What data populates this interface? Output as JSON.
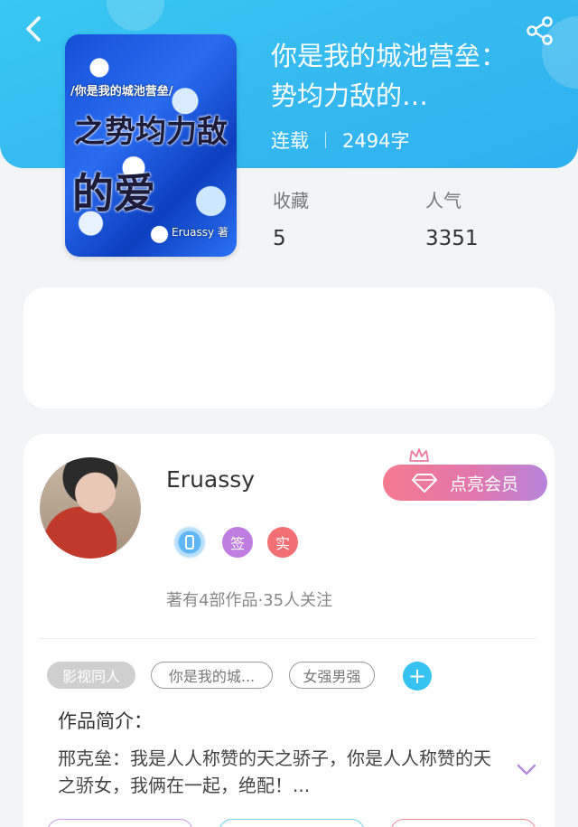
{
  "book": {
    "title": "你是我的城池营垒：势均力敌的…",
    "status": "连载",
    "word_count": "2494字",
    "cover": {
      "line": "/你是我的城池营垒/",
      "text_a": "之势均力敌",
      "text_b": "的爱",
      "author": "Eruassy 著"
    }
  },
  "stats": {
    "favorites_label": "收藏",
    "favorites_value": "5",
    "popularity_label": "人气",
    "popularity_value": "3351"
  },
  "author": {
    "name": "Eruassy",
    "vip_label": "点亮会员",
    "badge_sign": "签",
    "badge_real": "实",
    "works_info": "著有4部作品·35人关注"
  },
  "tags": [
    "影视同人",
    "你是我的城...",
    "女强男强"
  ],
  "tag_add": "+",
  "intro": {
    "title": "作品简介：",
    "text": "邢克垒：我是人人称赞的天之骄子，你是人人称赞的天之骄女，我俩在一起，绝配！..."
  },
  "icons": {
    "back": "chevron-left-icon",
    "share": "share-icon",
    "expand": "chevron-down-icon",
    "diamond": "diamond-icon",
    "crown": "crown-icon"
  },
  "colors": {
    "header_blue": "#35b9f0",
    "vip_start": "#f47b8f",
    "vip_end": "#b784dc",
    "sign_badge": "#c07de0",
    "real_badge": "#f26f73",
    "add_tag": "#36c3f2"
  }
}
